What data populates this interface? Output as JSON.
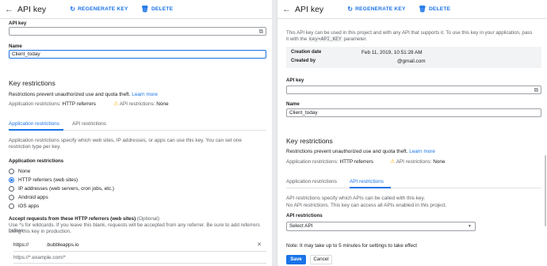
{
  "left": {
    "title": "API key",
    "regenerate": "REGENERATE KEY",
    "delete": "DELETE",
    "api_key_label": "API key",
    "name_label": "Name",
    "name_value": "Client_today",
    "key_restrictions_heading": "Key restrictions",
    "restrictions_desc": "Restrictions prevent unauthorized use and quota theft.",
    "learn_more": "Learn more",
    "app_restrictions_label": "Application restrictions:",
    "app_restrictions_value": "HTTP referrers",
    "api_restrictions_label": "API restrictions:",
    "api_restrictions_value": "None",
    "tab_app": "Application restrictions",
    "tab_api": "API restrictions",
    "app_desc_1": "Application restrictions specify which web sites, IP addresses, or apps can use this key. You can set one",
    "app_desc_2": "restriction type per key.",
    "app_restrictions_heading": "Application restrictions",
    "options": [
      "None",
      "HTTP referrers (web sites)",
      "IP addresses (web servers, cron jobs, etc.)",
      "Android apps",
      "iOS apps"
    ],
    "selected_option": 1,
    "referrers_heading": "Accept requests from these HTTP referrers (web sites)",
    "referrers_optional": "(Optional)",
    "referrers_help_1": "Use *s for wildcards. If you leave this blank, requests will be accepted from any referrer. Be sure to add referrers before",
    "referrers_help_2": "using this key in production.",
    "referrer_entry_prefix": "https://",
    "referrer_entry_suffix": ".bubbleapps.io",
    "referrer_placeholder": "https://*.example.com/*"
  },
  "right": {
    "title": "API key",
    "regenerate": "REGENERATE KEY",
    "delete": "DELETE",
    "intro_1": "This API key can be used in this project and with any API that supports it. To use this key in your application, pass",
    "intro_2_pre": "it with the",
    "intro_2_code": "key=API_KEY",
    "intro_2_post": "parameter.",
    "creation_date_label": "Creation date",
    "creation_date_value": "Feb 11, 2019, 10:51:28 AM",
    "created_by_label": "Created by",
    "created_by_value": "@gmail.com",
    "api_key_label": "API key",
    "name_label": "Name",
    "name_value": "Client_today",
    "key_restrictions_heading": "Key restrictions",
    "restrictions_desc": "Restrictions prevent unauthorized use and quota theft.",
    "learn_more": "Learn more",
    "app_restrictions_label": "Application restrictions:",
    "app_restrictions_value": "HTTP referrers",
    "api_restrictions_label": "API restrictions:",
    "api_restrictions_value": "None",
    "tab_app": "Application restrictions",
    "tab_api": "API restrictions",
    "api_desc_1": "API restrictions specify which APIs can be called with this key.",
    "api_desc_2": "No API restrictions. This key can access all APIs enabled in this project.",
    "api_restrictions_heading": "API restrictions",
    "select_value": "Select API",
    "note": "Note: It may take up to 5 minutes for settings to take effect",
    "save": "Save",
    "cancel": "Cancel"
  },
  "colors": {
    "accent": "#1a73e8",
    "warning": "#f9ab00",
    "text": "#202124",
    "muted": "#5f6368"
  },
  "icons": [
    "back-arrow-icon",
    "refresh-icon",
    "trash-icon",
    "copy-icon",
    "warning-icon",
    "close-icon",
    "dropdown-arrow-icon"
  ]
}
